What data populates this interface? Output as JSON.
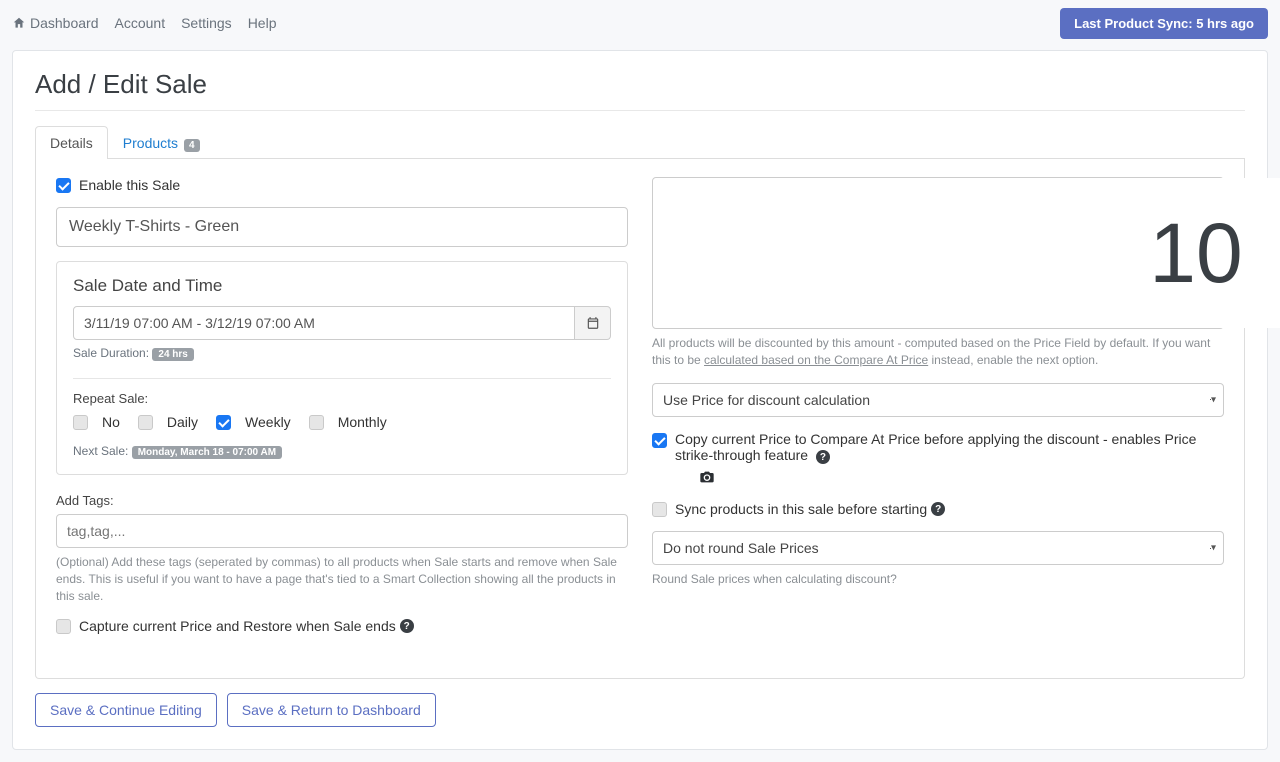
{
  "nav": {
    "dashboard": "Dashboard",
    "account": "Account",
    "settings": "Settings",
    "help": "Help"
  },
  "sync_button": "Last Product Sync: 5 hrs ago",
  "page_title": "Add / Edit Sale",
  "tabs": {
    "details": "Details",
    "products": "Products",
    "products_count": "4"
  },
  "left": {
    "enable_label": "Enable this Sale",
    "sale_name": "Weekly T-Shirts - Green",
    "date_box_title": "Sale Date and Time",
    "date_range": "3/11/19 07:00 AM - 3/12/19 07:00 AM",
    "duration_label": "Sale Duration:",
    "duration_value": "24 hrs",
    "repeat_label": "Repeat Sale:",
    "repeat_options": {
      "no": "No",
      "daily": "Daily",
      "weekly": "Weekly",
      "monthly": "Monthly"
    },
    "next_sale_label": "Next Sale:",
    "next_sale_value": "Monday, March 18 - 07:00 AM",
    "tags_label": "Add Tags:",
    "tags_placeholder": "tag,tag,...",
    "tags_hint": "(Optional) Add these tags (seperated by commas) to all products when Sale starts and remove when Sale ends. This is useful if you want to have a page that's tied to a Smart Collection showing all the products in this sale.",
    "capture_label": "Capture current Price and Restore when Sale ends"
  },
  "right": {
    "discount_value": "10",
    "discount_unit": "%",
    "discount_hint_pre": "All products will be discounted by this amount - computed based on the Price Field by default. If you want this to be ",
    "discount_hint_link": "calculated based on the Compare At Price",
    "discount_hint_post": " instead, enable the next option.",
    "price_basis": "Use Price for discount calculation",
    "copy_price_label": "Copy current Price to Compare At Price before applying the discount - enables Price strike-through feature",
    "sync_label": "Sync products in this sale before starting",
    "rounding": "Do not round Sale Prices",
    "rounding_hint": "Round Sale prices when calculating discount?"
  },
  "actions": {
    "save_continue": "Save & Continue Editing",
    "save_return": "Save & Return to Dashboard"
  }
}
